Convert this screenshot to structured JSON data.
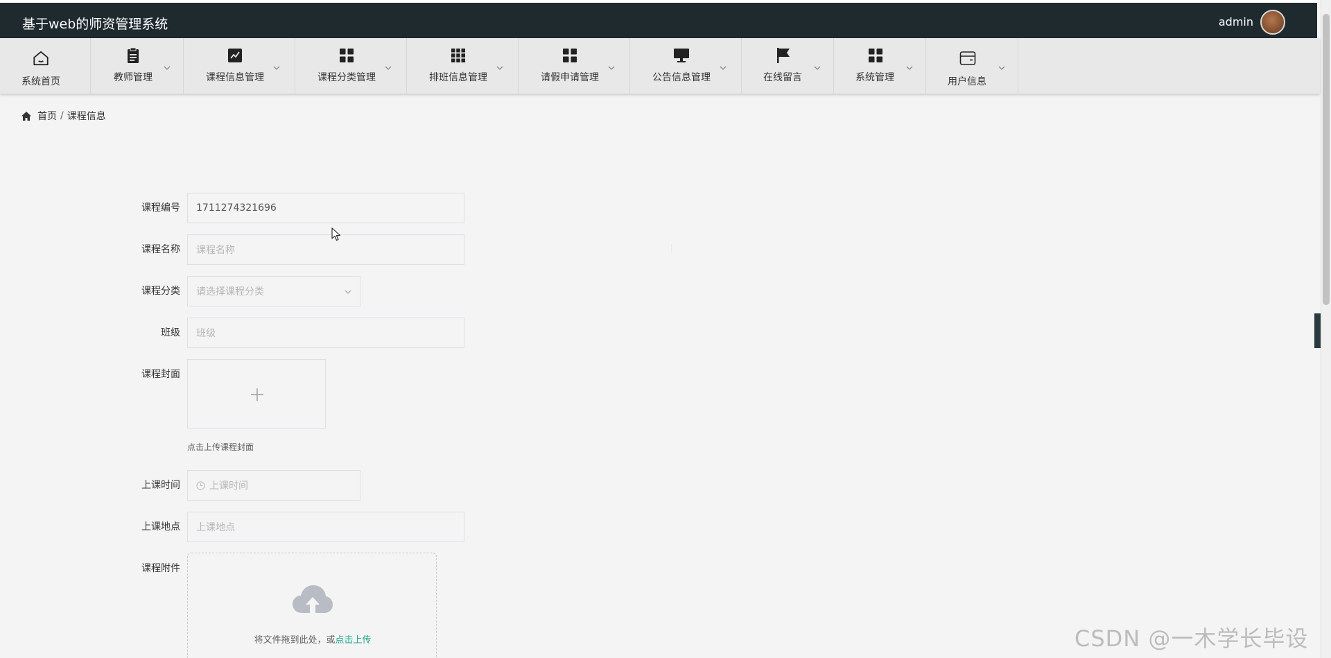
{
  "header": {
    "app_title": "基于web的师资管理系统",
    "user_name": "admin"
  },
  "nav": [
    {
      "label": "系统首页",
      "icon": "home-icon",
      "has_dropdown": false
    },
    {
      "label": "教师管理",
      "icon": "clipboard-icon",
      "has_dropdown": true
    },
    {
      "label": "课程信息管理",
      "icon": "chart-icon",
      "has_dropdown": true
    },
    {
      "label": "课程分类管理",
      "icon": "grid-icon",
      "has_dropdown": true
    },
    {
      "label": "排班信息管理",
      "icon": "apps-icon",
      "has_dropdown": true
    },
    {
      "label": "请假申请管理",
      "icon": "grid-icon",
      "has_dropdown": true
    },
    {
      "label": "公告信息管理",
      "icon": "monitor-icon",
      "has_dropdown": true
    },
    {
      "label": "在线留言",
      "icon": "flag-icon",
      "has_dropdown": true
    },
    {
      "label": "系统管理",
      "icon": "grid-icon",
      "has_dropdown": true
    },
    {
      "label": "用户信息",
      "icon": "wallet-icon",
      "has_dropdown": true
    }
  ],
  "breadcrumb": {
    "home": "首页",
    "separator": "/",
    "current": "课程信息"
  },
  "form": {
    "course_no": {
      "label": "课程编号",
      "value": "1711274321696"
    },
    "course_name": {
      "label": "课程名称",
      "placeholder": "课程名称"
    },
    "course_category": {
      "label": "课程分类",
      "placeholder": "请选择课程分类"
    },
    "class": {
      "label": "班级",
      "placeholder": "班级"
    },
    "cover": {
      "label": "课程封面",
      "hint": "点击上传课程封面"
    },
    "class_time": {
      "label": "上课时间",
      "placeholder": "上课时间"
    },
    "location": {
      "label": "上课地点",
      "placeholder": "上课地点"
    },
    "attachment": {
      "label": "课程附件",
      "drag_text": "将文件拖到此处，或",
      "click_text": "点击上传"
    }
  },
  "watermark": "CSDN @一木学长毕设",
  "colors": {
    "header_bg": "#1f2a2f",
    "nav_bg": "#e8e8e8",
    "page_bg": "#f4f4f4",
    "accent": "#17a589"
  }
}
